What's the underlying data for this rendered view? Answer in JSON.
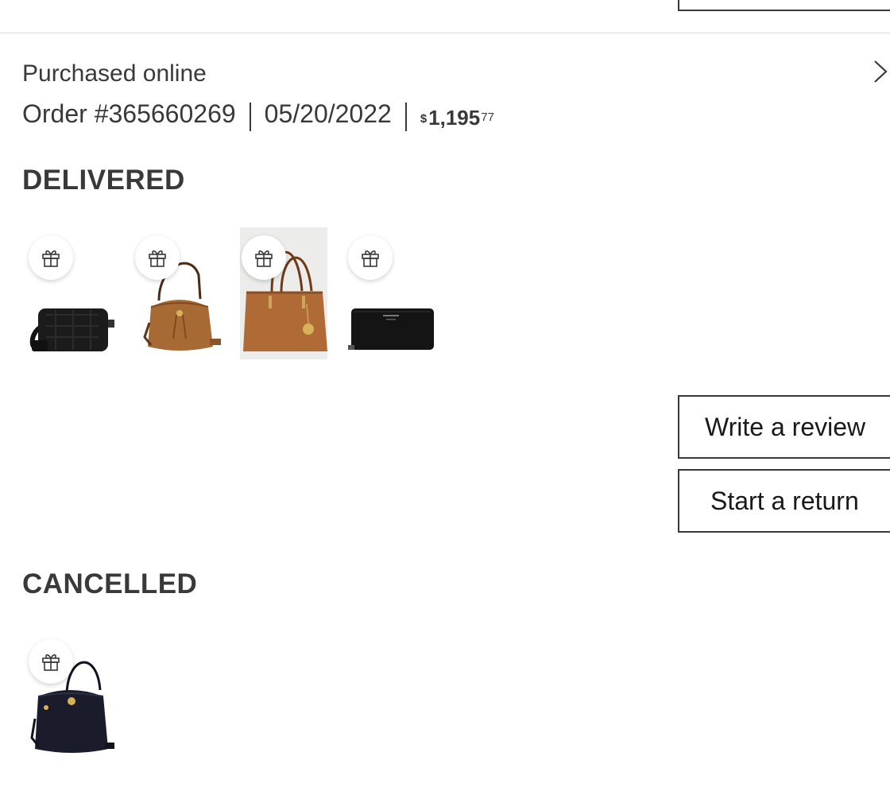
{
  "order": {
    "purchase_channel": "Purchased online",
    "order_number": "Order #365660269",
    "order_date": "05/20/2022",
    "total": {
      "currency": "$",
      "whole": "1,195",
      "cents": "77"
    }
  },
  "sections": {
    "delivered": {
      "title": "DELIVERED",
      "items": [
        {
          "name": "black quilted camera bag",
          "icon": "gift-icon",
          "color": "#1b1b1b"
        },
        {
          "name": "tan leather bucket bag",
          "icon": "gift-icon",
          "color": "#a86a35"
        },
        {
          "name": "brown leather tote bag",
          "icon": "gift-icon",
          "color": "#b06a36"
        },
        {
          "name": "black zip-around wallet",
          "icon": "gift-icon",
          "color": "#141414"
        }
      ]
    },
    "cancelled": {
      "title": "CANCELLED",
      "items": [
        {
          "name": "navy leather bucket bag",
          "icon": "gift-icon",
          "color": "#1a1c2c"
        }
      ]
    }
  },
  "actions": {
    "write_review": "Write a review",
    "start_return": "Start a return"
  },
  "icons": {
    "chevron": "chevron-right-icon",
    "gift": "gift-icon"
  }
}
